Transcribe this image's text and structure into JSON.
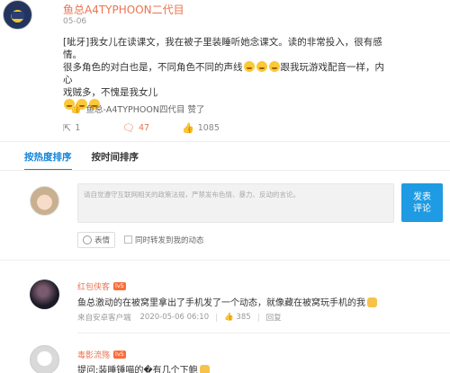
{
  "post": {
    "username": "鱼总A4TYPHOON二代目",
    "date": "05-06",
    "text_line1": "[呲牙]我女儿在读课文，我在被子里装睡听她念课文。读的非常投入，很有感情。",
    "text_line2_a": "很多角色的对白也是，不同角色不同的声线",
    "text_line2_b": "跟我玩游戏配音一样，内心",
    "text_line3": "戏贼多，不愧是我女儿",
    "liked_by": "鱼总-A4TYPHOON四代目 赞了",
    "stats": {
      "repost": "1",
      "comments": "47",
      "likes": "1085"
    }
  },
  "sort_tabs": {
    "hot": "按热度排序",
    "time": "按时间排序"
  },
  "reply": {
    "placeholder": "请自觉遵守互联网相关的政策法规，严禁发布色情、暴力、反动的言论。",
    "submit_line1": "发表",
    "submit_line2": "评论",
    "emoji_label": "表情",
    "repost_option": "同时转发到我的动态"
  },
  "comments": [
    {
      "name": "红包侠客",
      "badge": "lv5",
      "text": "鱼总激动的在被窝里拿出了手机发了一个动态，就像藏在被窝玩手机的我",
      "source": "来自安卓客户端",
      "time": "2020-05-06 06:10",
      "likes": "385",
      "reply_label": "回复"
    },
    {
      "name": "毒影流殇",
      "badge": "lv5",
      "text": "提问:装睡锤喵的�有几个下鲍"
    }
  ],
  "colors": {
    "accent": "#1384d8",
    "username": "#eb7350",
    "submit": "#1e9be2"
  }
}
